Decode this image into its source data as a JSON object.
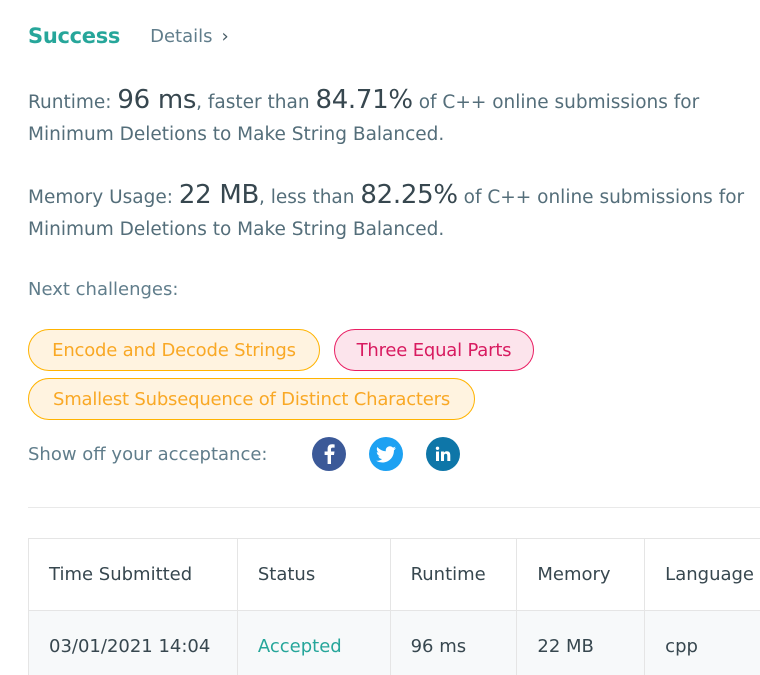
{
  "header": {
    "status": "Success",
    "details_label": "Details",
    "details_chevron": "›"
  },
  "runtime": {
    "label": "Runtime:",
    "value": "96 ms",
    "comparison": ", faster than",
    "percent": "84.71%",
    "suffix": "of C++ online submissions for Minimum Deletions to Make String Balanced."
  },
  "memory": {
    "label": "Memory Usage:",
    "value": "22 MB",
    "comparison": ", less than",
    "percent": "82.25%",
    "suffix": "of C++ online submissions for Minimum Deletions to Make String Balanced."
  },
  "next": {
    "label": "Next challenges:",
    "challenges": [
      {
        "title": "Encode and Decode Strings",
        "difficulty": "medium"
      },
      {
        "title": "Three Equal Parts",
        "difficulty": "hard"
      },
      {
        "title": "Smallest Subsequence of Distinct Characters",
        "difficulty": "medium"
      }
    ]
  },
  "share": {
    "label": "Show off your acceptance:",
    "icons": [
      "facebook-icon",
      "twitter-icon",
      "linkedin-icon"
    ],
    "colors": {
      "facebook": "#3b5998",
      "twitter": "#1da1f2",
      "linkedin": "#0e76a8"
    }
  },
  "table": {
    "columns": [
      "Time Submitted",
      "Status",
      "Runtime",
      "Memory",
      "Language"
    ],
    "rows": [
      [
        "03/01/2021 14:04",
        "Accepted",
        "96 ms",
        "22 MB",
        "cpp"
      ]
    ]
  },
  "colors": {
    "success": "#26a69a",
    "medium_text": "#f9a825",
    "medium_border": "#ffb300",
    "hard_text": "#d81b60",
    "hard_border": "#e91e63"
  }
}
